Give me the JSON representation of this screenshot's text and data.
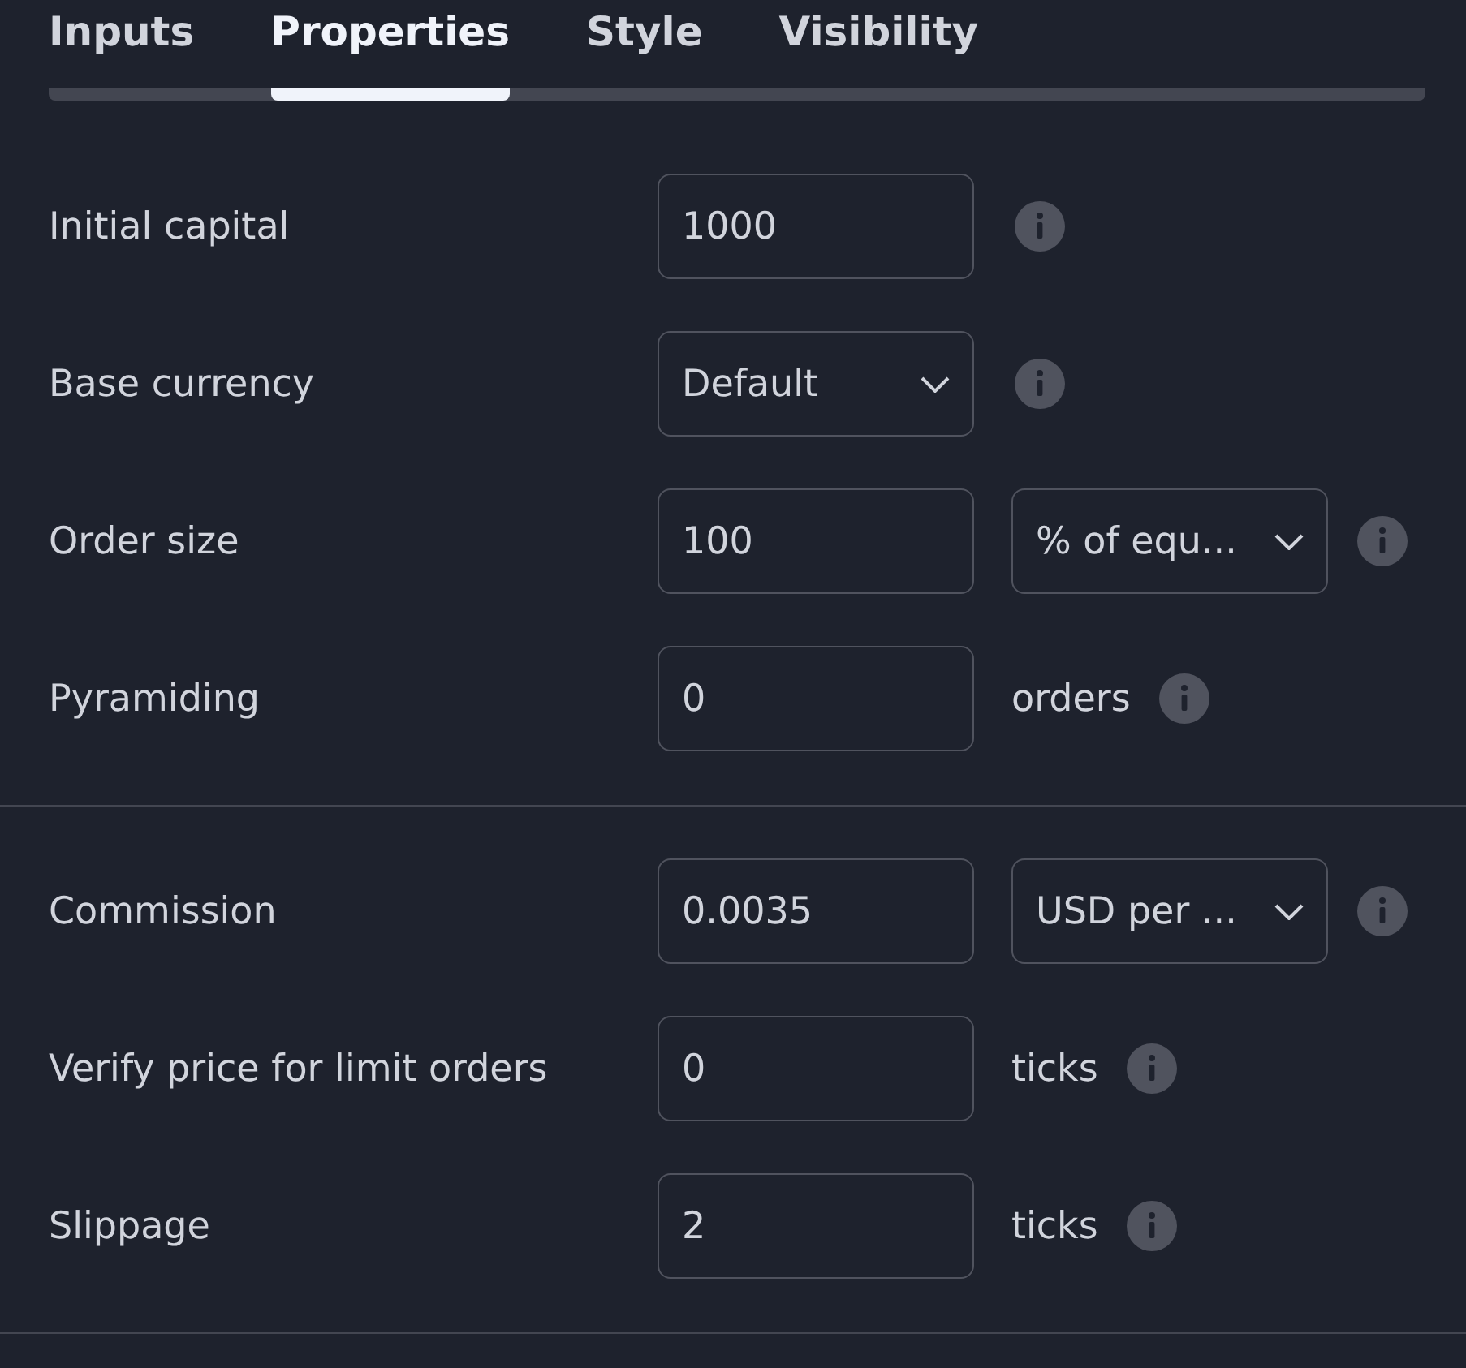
{
  "tabs": [
    {
      "label": "Inputs",
      "selected": false
    },
    {
      "label": "Properties",
      "selected": true
    },
    {
      "label": "Style",
      "selected": false
    },
    {
      "label": "Visibility",
      "selected": false
    }
  ],
  "sections": [
    {
      "rows": [
        {
          "label": "Initial capital",
          "field": {
            "kind": "input",
            "value": "1000"
          }
        },
        {
          "label": "Base currency",
          "field": {
            "kind": "select",
            "value": "Default"
          }
        },
        {
          "label": "Order size",
          "field": {
            "kind": "input",
            "value": "100"
          },
          "extra": {
            "kind": "select",
            "value": "% of equ..."
          }
        },
        {
          "label": "Pyramiding",
          "field": {
            "kind": "input",
            "value": "0"
          },
          "extra": {
            "kind": "unit",
            "value": "orders"
          }
        }
      ]
    },
    {
      "rows": [
        {
          "label": "Commission",
          "field": {
            "kind": "input",
            "value": "0.0035"
          },
          "extra": {
            "kind": "select",
            "value": "USD per ..."
          }
        },
        {
          "label": "Verify price for limit orders",
          "field": {
            "kind": "input",
            "value": "0"
          },
          "extra": {
            "kind": "unit",
            "value": "ticks"
          }
        },
        {
          "label": "Slippage",
          "field": {
            "kind": "input",
            "value": "2"
          },
          "extra": {
            "kind": "unit",
            "value": "ticks"
          }
        }
      ]
    }
  ]
}
